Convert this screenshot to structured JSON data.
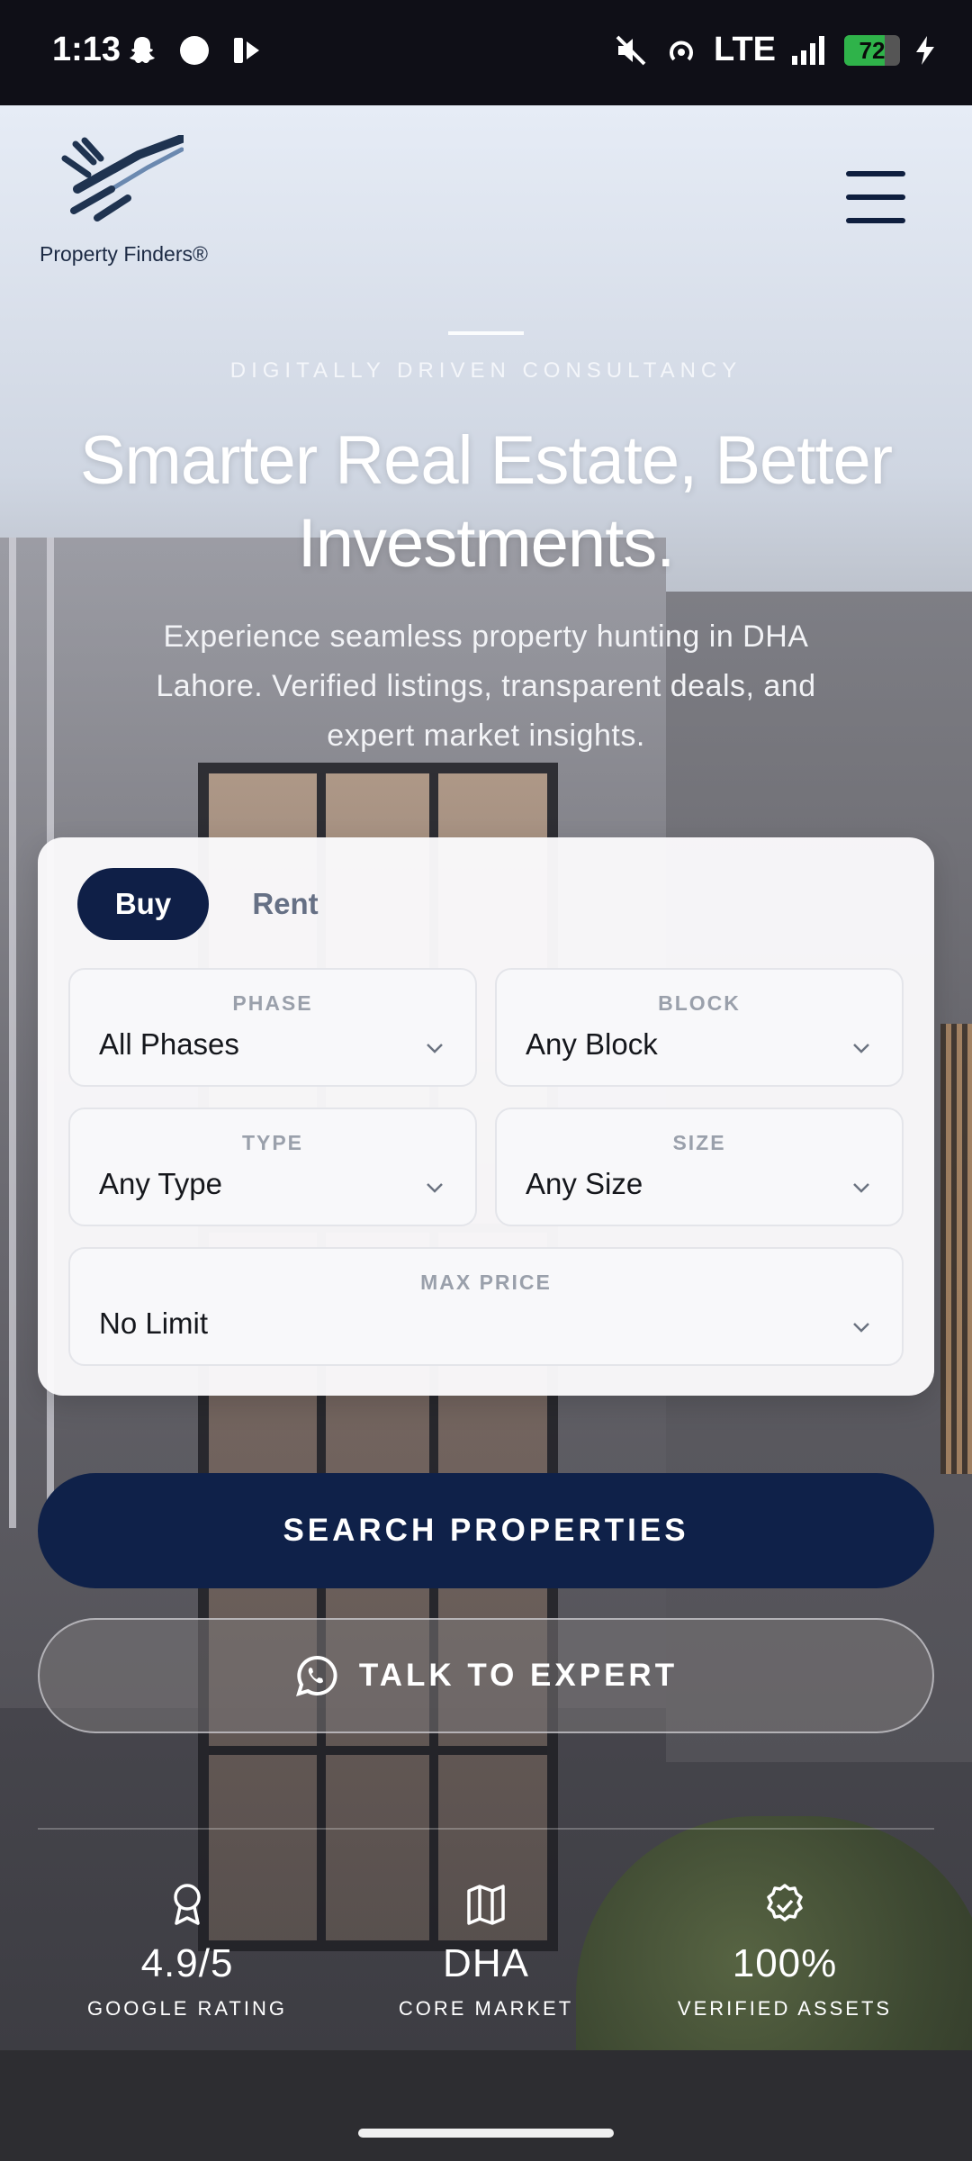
{
  "status_bar": {
    "time": "1:13",
    "network": "LTE",
    "battery": "72",
    "battery_level": 0.72,
    "icons": [
      "snapchat-icon",
      "circle-icon",
      "stream-icon",
      "mute-icon",
      "hotspot-icon",
      "signal-icon",
      "battery-icon",
      "charging-icon"
    ]
  },
  "header": {
    "logo_text": "Property Finders®",
    "menu_icon": "hamburger-menu-icon"
  },
  "hero": {
    "eyebrow": "DIGITALLY DRIVEN CONSULTANCY",
    "headline_line1": "Smarter Real Estate, Better",
    "headline_line2": "Investments.",
    "subtext": "Experience seamless property hunting in DHA Lahore. Verified listings, transparent deals, and expert market insights."
  },
  "search": {
    "tabs": [
      {
        "label": "Buy",
        "active": true
      },
      {
        "label": "Rent",
        "active": false
      }
    ],
    "fields": {
      "phase": {
        "label": "PHASE",
        "value": "All Phases"
      },
      "block": {
        "label": "BLOCK",
        "value": "Any Block"
      },
      "type": {
        "label": "TYPE",
        "value": "Any Type"
      },
      "size": {
        "label": "SIZE",
        "value": "Any Size"
      },
      "max_price": {
        "label": "MAX PRICE",
        "value": "No Limit"
      }
    },
    "search_button": "SEARCH PROPERTIES",
    "expert_button": "TALK TO EXPERT"
  },
  "stats": [
    {
      "value": "4.9/5",
      "caption": "GOOGLE RATING",
      "icon": "award-icon"
    },
    {
      "value": "DHA",
      "caption": "CORE MARKET",
      "icon": "map-icon"
    },
    {
      "value": "100%",
      "caption": "VERIFIED ASSETS",
      "icon": "verified-badge-icon"
    }
  ],
  "colors": {
    "navy": "#0f2149",
    "battery_green": "#2fb34a"
  }
}
